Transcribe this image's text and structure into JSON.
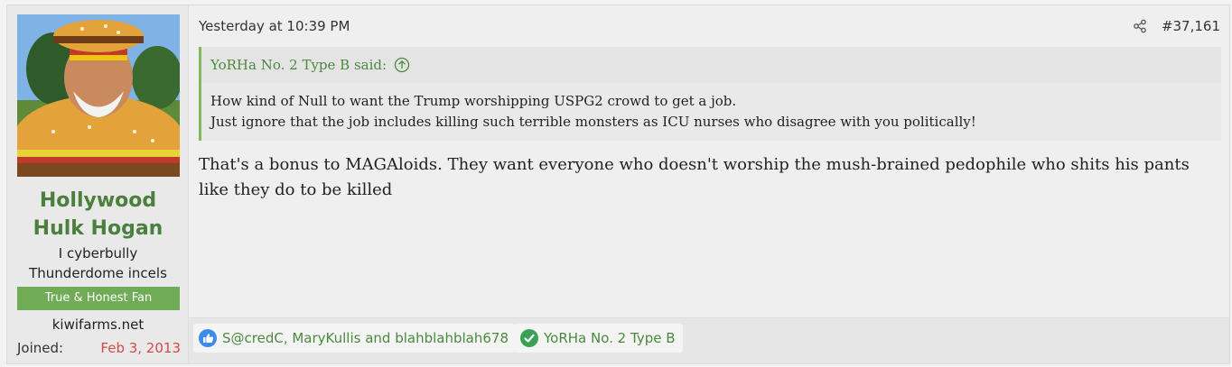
{
  "user": {
    "name": "Hollywood Hulk Hogan",
    "title_line1": "I cyberbully",
    "title_line2": "Thunderdome incels",
    "banner": "True & Honest Fan",
    "site": "kiwifarms.net",
    "joined_label": "Joined:",
    "joined_date": "Feb 3, 2013"
  },
  "post": {
    "date": "Yesterday at 10:39 PM",
    "number": "#37,161",
    "quote": {
      "author": "YoRHa No. 2 Type B said:",
      "line1": "How kind of Null to want the Trump worshipping USPG2 crowd to get a job.",
      "line2": "Just ignore that the job includes killing such terrible monsters as ICU nurses who disagree with you politically!"
    },
    "message": "That's a bonus to MAGAloids. They want everyone who doesn't worship the mush-brained pedophile who shits his pants like they do to be killed"
  },
  "reactions": [
    {
      "icon": "thumbs-up-icon",
      "users": "S@credC, MaryKullis and blahblahblah678"
    },
    {
      "icon": "check-icon",
      "users": "YoRHa No. 2 Type B"
    }
  ],
  "colors": {
    "username": "#4a7f3e",
    "banner": "#6fac55",
    "joined_date": "#d24b4b",
    "quote_border": "#7fba5e",
    "link_green": "#4a8a3e"
  }
}
